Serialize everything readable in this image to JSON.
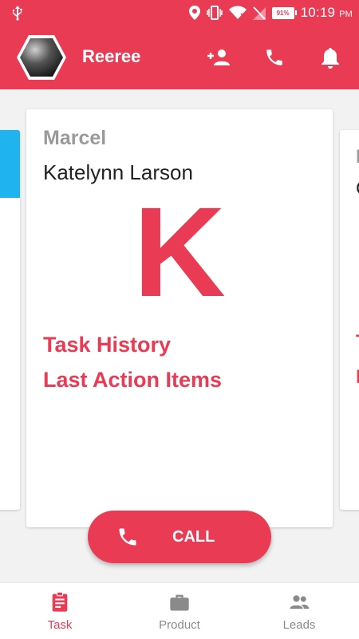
{
  "colors": {
    "brand": "#ea3b55",
    "accent_card": "#1fb3ef",
    "muted": "#9a9a9a"
  },
  "status_bar": {
    "battery": "91%",
    "time": "10:19",
    "ampm": "PM",
    "icons": [
      "usb-icon",
      "location-icon",
      "vibrate-icon",
      "wifi-icon",
      "no-sim-icon",
      "battery-icon"
    ]
  },
  "appbar": {
    "title": "Reeree",
    "actions": [
      "add-person-icon",
      "phone-icon",
      "bell-icon"
    ]
  },
  "card": {
    "company": "Marcel",
    "name": "Katelynn Larson",
    "initial": "K",
    "links": {
      "task_history": "Task History",
      "last_action_items": "Last Action Items"
    }
  },
  "right_card_partial": {
    "line1": "I",
    "line2": "C",
    "line3": "T",
    "line4": "I"
  },
  "call_button": {
    "label": "CALL"
  },
  "bottom_nav": {
    "items": [
      {
        "label": "Task",
        "icon": "clipboard-icon",
        "active": true
      },
      {
        "label": "Product",
        "icon": "briefcase-icon",
        "active": false
      },
      {
        "label": "Leads",
        "icon": "people-icon",
        "active": false
      }
    ]
  }
}
